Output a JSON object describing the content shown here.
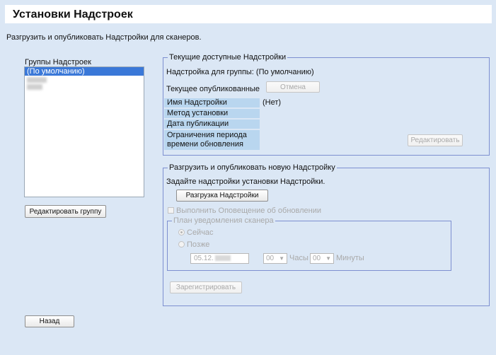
{
  "header": {
    "title": "Установки Надстроек"
  },
  "subtitle": "Разгрузить и опубликовать Надстройки для сканеров.",
  "groups": {
    "label": "Группы Надстроек",
    "items": [
      "(По умолчанию)"
    ],
    "edit_button": "Редактировать группу"
  },
  "current": {
    "legend": "Текущие доступные Надстройки",
    "group_line": "Надстройка для группы: (По умолчанию)",
    "published_label": "Текущее опубликованные",
    "cancel_button": "Отмена",
    "name_label": "Имя Надстройки",
    "name_value": "(Нет)",
    "method_label": "Метод установки",
    "date_label": "Дата публикации",
    "period_label": "Ограничения периода времени обновления",
    "edit_button": "Редактировать"
  },
  "upload": {
    "legend": "Разгрузить и опубликовать новую Надстройку",
    "instruction": "Задайте надстройки установки Надстройки.",
    "upload_button": "Разгрузка Надстройки",
    "notify_checkbox": "Выполнить Оповещение об обновлении",
    "schedule": {
      "legend": "План уведомления сканера",
      "now": "Сейчас",
      "later": "Позже",
      "date_value": "05.12.",
      "hours_value": "00",
      "hours_label": "Часы",
      "minutes_value": "00",
      "minutes_label": "Минуты"
    },
    "register_button": "Зарегистрировать"
  },
  "back_button": "Назад"
}
